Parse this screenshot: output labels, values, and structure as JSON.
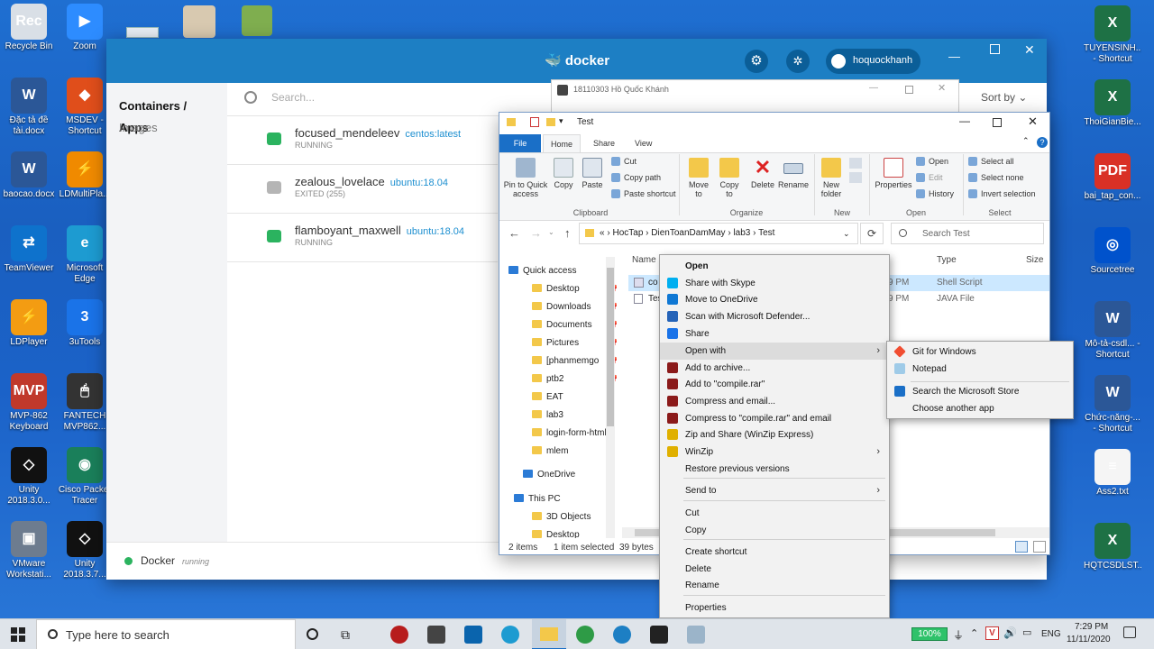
{
  "desktop_left": [
    {
      "label": "Recycle Bin",
      "color": "#d9dfe6",
      "glyph": "Rec"
    },
    {
      "label": "Zoom",
      "color": "#2d8cff",
      "glyph": "▶"
    },
    {
      "label": "Đặc tả đề tài.docx",
      "color": "#2b5797",
      "glyph": "W"
    },
    {
      "label": "MSDEV - Shortcut",
      "color": "#e04e1b",
      "glyph": "◆"
    },
    {
      "label": "baocao.docx",
      "color": "#2b5797",
      "glyph": "W"
    },
    {
      "label": "LDMultiPla...",
      "color": "#f08a00",
      "glyph": "⚡"
    },
    {
      "label": "TeamViewer",
      "color": "#0e72cc",
      "glyph": "⇄"
    },
    {
      "label": "Microsoft Edge",
      "color": "#1d9bd1",
      "glyph": "e"
    },
    {
      "label": "LDPlayer",
      "color": "#f39c12",
      "glyph": "⚡"
    },
    {
      "label": "3uTools",
      "color": "#1a73e8",
      "glyph": "3"
    },
    {
      "label": "MVP-862 Keyboard",
      "color": "#c0392b",
      "glyph": "MVP"
    },
    {
      "label": "FANTECH MVP862...",
      "color": "#333333",
      "glyph": "🖱"
    },
    {
      "label": "Unity 2018.3.0...",
      "color": "#111111",
      "glyph": "◇"
    },
    {
      "label": "Cisco Packet Tracer",
      "color": "#1a7f5a",
      "glyph": "◉"
    },
    {
      "label": "VMware Workstati...",
      "color": "#6d7c8f",
      "glyph": "▣"
    },
    {
      "label": "Unity 2018.3.7...",
      "color": "#111111",
      "glyph": "◇"
    }
  ],
  "desktop_right": [
    {
      "label": "TUYENSINH... - Shortcut",
      "color": "#1e7145",
      "glyph": "X"
    },
    {
      "label": "ThoiGianBie...",
      "color": "#1e7145",
      "glyph": "X"
    },
    {
      "label": "bai_tap_con...",
      "color": "#d93025",
      "glyph": "PDF"
    },
    {
      "label": "Sourcetree",
      "color": "#0052cc",
      "glyph": "◎"
    },
    {
      "label": "Mô-tả-csdl... - Shortcut",
      "color": "#2b5797",
      "glyph": "W"
    },
    {
      "label": "Chức-năng-... - Shortcut",
      "color": "#2b5797",
      "glyph": "W"
    },
    {
      "label": "Ass2.txt",
      "color": "#f5f5f5",
      "glyph": "≡"
    },
    {
      "label": "HQTCSDLST...",
      "color": "#1e7145",
      "glyph": "X"
    }
  ],
  "docker": {
    "brand": "docker",
    "user": "hoquockhanh",
    "nav_active": "Containers / Apps",
    "nav_images": "Images",
    "search_placeholder": "Search...",
    "sort_label": "Sort by",
    "containers": [
      {
        "name": "focused_mendeleev",
        "image": "centos:latest",
        "status": "RUNNING",
        "color": "#2bb35f"
      },
      {
        "name": "zealous_lovelace",
        "image": "ubuntu:18.04",
        "status": "EXITED (255)",
        "color": "#b5b5b5"
      },
      {
        "name": "flamboyant_maxwell",
        "image": "ubuntu:18.04",
        "status": "RUNNING",
        "color": "#2bb35f"
      }
    ],
    "footer_app": "Docker",
    "footer_status": "running"
  },
  "bg_window": {
    "title": "18110303 Hồ Quốc Khánh"
  },
  "explorer": {
    "title": "Test",
    "ribbon_tabs": [
      "File",
      "Home",
      "Share",
      "View"
    ],
    "clipboard": {
      "pin": "Pin to Quick access",
      "copy": "Copy",
      "paste": "Paste",
      "cut": "Cut",
      "copy_path": "Copy path",
      "paste_shortcut": "Paste shortcut",
      "group": "Clipboard"
    },
    "organize": {
      "move_to": "Move to",
      "copy_to": "Copy to",
      "delete": "Delete",
      "rename": "Rename",
      "group": "Organize"
    },
    "new": {
      "new_folder": "New folder",
      "group": "New"
    },
    "open": {
      "properties": "Properties",
      "open": "Open",
      "edit": "Edit",
      "history": "History",
      "group": "Open"
    },
    "select": {
      "select_all": "Select all",
      "select_none": "Select none",
      "invert": "Invert selection",
      "group": "Select"
    },
    "breadcrumb": [
      "«",
      "HocTap",
      "DienToanDamMay",
      "lab3",
      "Test"
    ],
    "search_placeholder": "Search Test",
    "columns": {
      "name": "Name",
      "type": "Type",
      "size": "Size"
    },
    "files": [
      {
        "name": "co",
        "date": "9 PM",
        "type": "Shell Script"
      },
      {
        "name": "Tes",
        "date": "9 PM",
        "type": "JAVA File"
      }
    ],
    "nav": [
      "Quick access",
      "Desktop",
      "Downloads",
      "Documents",
      "Pictures",
      "[phanmemgo",
      "ptb2",
      "EAT",
      "lab3",
      "login-form-html",
      "mlem",
      "OneDrive",
      "This PC",
      "3D Objects",
      "Desktop"
    ],
    "status_items": "2 items",
    "status_selected": "1 item selected",
    "status_size": "39 bytes"
  },
  "context_menu": {
    "items": [
      "Open",
      "Share with Skype",
      "Move to OneDrive",
      "Scan with Microsoft Defender...",
      "Share",
      "Open with",
      "Add to archive...",
      "Add to \"compile.rar\"",
      "Compress and email...",
      "Compress to \"compile.rar\" and email",
      "Zip and Share (WinZip Express)",
      "WinZip",
      "Restore previous versions",
      "Send to",
      "Cut",
      "Copy",
      "Create shortcut",
      "Delete",
      "Rename",
      "Properties"
    ]
  },
  "submenu": {
    "items": [
      "Git for Windows",
      "Notepad",
      "Search the Microsoft Store",
      "Choose another app"
    ]
  },
  "taskbar": {
    "search_placeholder": "Type here to search",
    "battery": "100%",
    "lang": "ENG",
    "time": "7:29 PM",
    "date": "11/11/2020"
  }
}
